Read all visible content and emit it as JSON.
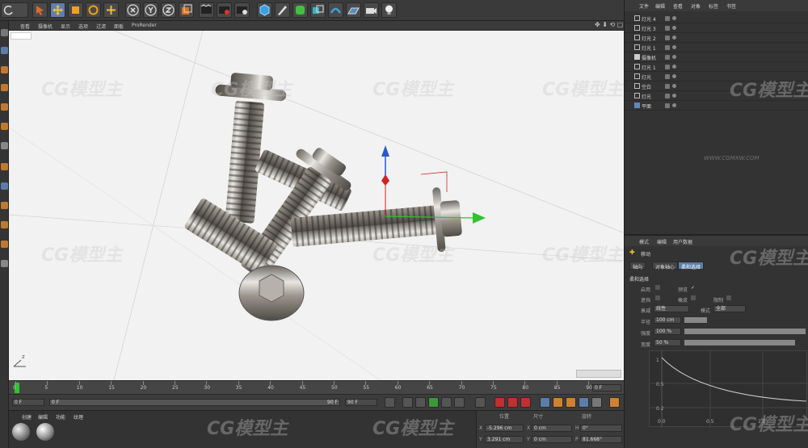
{
  "viewport_menu": [
    "查看",
    "摄像机",
    "显示",
    "选项",
    "过滤",
    "面板",
    "ProRender"
  ],
  "object_manager": {
    "menu": [
      "文件",
      "编辑",
      "查看",
      "对象",
      "标签",
      "书签"
    ],
    "objects": [
      {
        "name": "灯光 4",
        "icon": "light"
      },
      {
        "name": "灯光 3",
        "icon": "light"
      },
      {
        "name": "灯光 2",
        "icon": "light"
      },
      {
        "name": "灯光 1",
        "icon": "light"
      },
      {
        "name": "摄像机",
        "icon": "camera"
      },
      {
        "name": "灯光 1",
        "icon": "light"
      },
      {
        "name": "灯光",
        "icon": "light"
      },
      {
        "name": "空白",
        "icon": "null"
      },
      {
        "name": "灯光",
        "icon": "light"
      },
      {
        "name": "平面",
        "icon": "plane"
      }
    ]
  },
  "attributes": {
    "menu": [
      "模式",
      "编辑",
      "用户数据"
    ],
    "title": "移动",
    "tabs": [
      "轴向",
      "对象轴心",
      "柔和选择"
    ],
    "active_tab": "柔和选择",
    "section": "柔和选择",
    "labels": [
      "启用",
      "预览",
      "遮挡",
      "橡皮",
      "限制",
      "模式",
      "衰减",
      "半径",
      "强度",
      "宽度"
    ],
    "check_mark": "✓",
    "falloff_value": "线性",
    "mode_value": "全部",
    "radius": "100 cm",
    "strength": "100 %",
    "width": "50 %",
    "graph_y": [
      "1",
      "0.5",
      "0.2"
    ],
    "graph_x": [
      "0.0",
      "0.5",
      "1.0"
    ]
  },
  "timeline": {
    "ticks": [
      "0",
      "5",
      "10",
      "15",
      "20",
      "25",
      "30",
      "35",
      "40",
      "45",
      "50",
      "55",
      "60",
      "65",
      "70",
      "75",
      "80",
      "85",
      "90"
    ],
    "current_frame": "0 F",
    "end_label": "0 F"
  },
  "playbar": {
    "start": "0 F",
    "range_start": "0 F",
    "range_end": "90 F",
    "end": "90 F"
  },
  "materials": {
    "menu": [
      "创建",
      "编辑",
      "功能",
      "纹理"
    ]
  },
  "coords": {
    "headers": [
      "位置",
      "尺寸",
      "旋转"
    ],
    "x_pos": "-5.296 cm",
    "x_size": "0 cm",
    "h_rot": "0°",
    "y_pos": "3.291 cm",
    "y_size": "0 cm",
    "p_rot": "81.668°",
    "axis_labels": [
      "X",
      "Y",
      "X",
      "Y",
      "H",
      "P"
    ]
  },
  "axis_gizmo_label": "z",
  "watermark": "CG模型主",
  "watermark_url": "WWW.CGMXW.COM",
  "colors": {
    "accent": "#5a7ea8",
    "viewport_bg": "#f2f2f2",
    "panel": "#333333",
    "axis_y": "#2a59c9",
    "axis_x": "#2fc42f",
    "axis_z": "#d02525"
  }
}
